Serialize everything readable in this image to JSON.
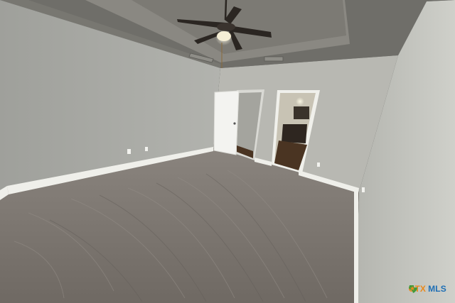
{
  "photo": {
    "subject": "empty-bedroom",
    "colors": {
      "left_wall": "#a9aaa5",
      "back_wall": "#b8b8b2",
      "right_wall": "#c3c4be",
      "ceiling": "#6f6e69",
      "tray_ceiling": "#817f79",
      "carpet": "#79736d",
      "baseboard": "#efefea",
      "door": "#f3f3f0",
      "wood_floor": "#4a3422"
    }
  },
  "watermark": {
    "brand_ctx": "CTX",
    "brand_mls": "MLS",
    "colors": {
      "ctx": "#e98a1e",
      "mls": "#1f6fb5",
      "icon": "#3f9a3a"
    },
    "icon": "texas-star-icon"
  }
}
